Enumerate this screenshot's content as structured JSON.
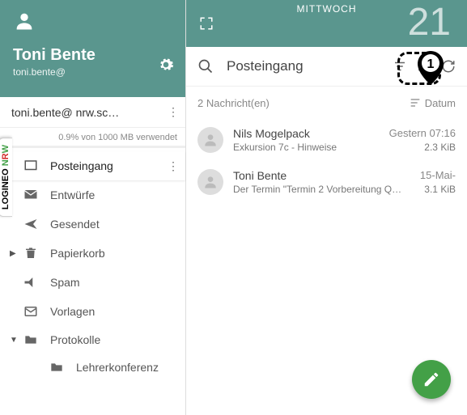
{
  "header": {
    "user_name": "Toni Bente",
    "user_email": "toni.bente@",
    "day_label": "MITTWOCH",
    "day_number": "21"
  },
  "account": {
    "email": "toni.bente@         nrw.sc…",
    "quota": "0.9% von 1000 MB verwendet"
  },
  "folders": {
    "inbox": "Posteingang",
    "drafts": "Entwürfe",
    "sent": "Gesendet",
    "trash": "Papierkorb",
    "spam": "Spam",
    "templates": "Vorlagen",
    "protocols": "Protokolle",
    "teacher_conf": "Lehrerkonferenz"
  },
  "search": {
    "title": "Posteingang"
  },
  "meta": {
    "count": "2 Nachricht(en)",
    "sort": "Datum"
  },
  "messages": [
    {
      "sender": "Nils Mogelpack",
      "date": "Gestern 07:16",
      "subject": "Exkursion 7c - Hinweise",
      "size": "2.3 KiB"
    },
    {
      "sender": "Toni Bente",
      "date": "15-Mai-",
      "subject": "Der Termin \"Termin 2 Vorbereitung Q…",
      "size": "3.1 KiB"
    }
  ],
  "sidetab": {
    "part1": "LOGINEO",
    "part2": " N",
    "part3": "R",
    "part4": "W"
  },
  "callout_num": "1"
}
